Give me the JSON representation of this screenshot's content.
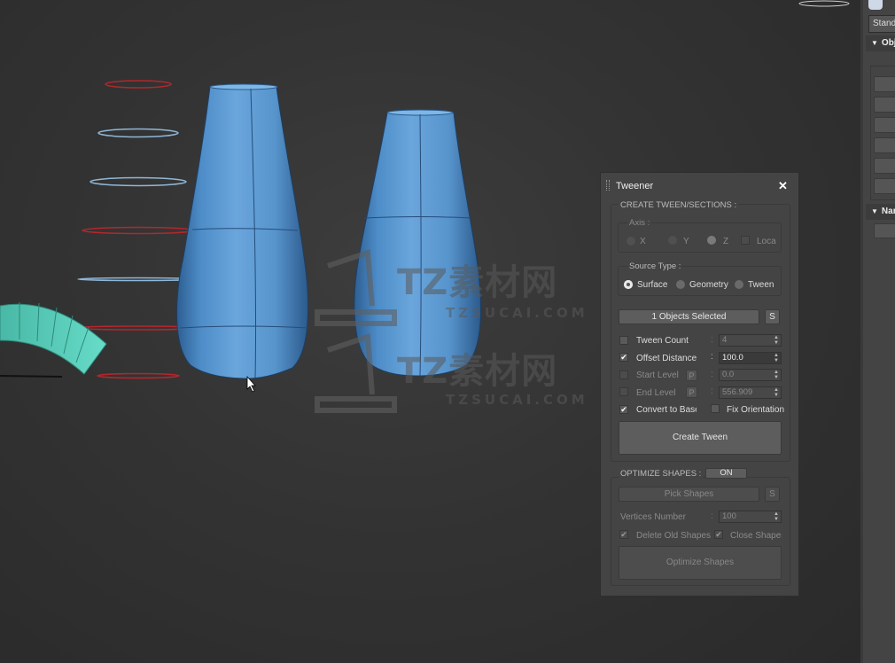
{
  "watermark": {
    "brand": "TZ素材网",
    "site": "TZSUCAI.COM"
  },
  "command_panel": {
    "dropdown_text": "Standa",
    "rollout_object_type": "Obj",
    "rollout_name_color": "Nar"
  },
  "tweener": {
    "title": "Tweener",
    "close_symbol": "✕",
    "create_section": {
      "label": "CREATE TWEEN/SECTIONS :",
      "axis_label": "Axis :",
      "axis_options": [
        "X",
        "Y",
        "Z"
      ],
      "axis_selected": "Z",
      "local_label": "Loca",
      "source_type_label": "Source Type :",
      "source_types": [
        "Surface",
        "Geometry",
        "Tween"
      ],
      "source_selected": "Surface",
      "objects_selected": "1 Objects Selected",
      "s_button": "S",
      "p_button": "P",
      "tween_count_label": "Tween Count",
      "tween_count_value": "4",
      "offset_distance_label": "Offset Distance",
      "offset_distance_value": "100.0",
      "start_level_label": "Start Level",
      "start_level_value": "0.0",
      "end_level_label": "End Level",
      "end_level_value": "556.909",
      "convert_to_base_label": "Convert to Base",
      "fix_orientation_label": "Fix Orientation",
      "create_button": "Create Tween"
    },
    "optimize_section": {
      "label": "OPTIMIZE SHAPES :",
      "toggle": "ON",
      "pick_shapes": "Pick Shapes",
      "s_button": "S",
      "vertices_label": "Vertices Number",
      "vertices_value": "100",
      "delete_old_label": "Delete Old Shapes",
      "close_shapes_label": "Close Shapes",
      "optimize_button": "Optimize Shapes"
    },
    "check_mark": "✔",
    "colon": ":"
  },
  "colors": {
    "viewport_bg": "#333333",
    "vase": "#5b9bd5",
    "spline_red": "#b3272d",
    "spline_blue": "#8fb7d8",
    "teal_object": "#5fd3c0"
  }
}
